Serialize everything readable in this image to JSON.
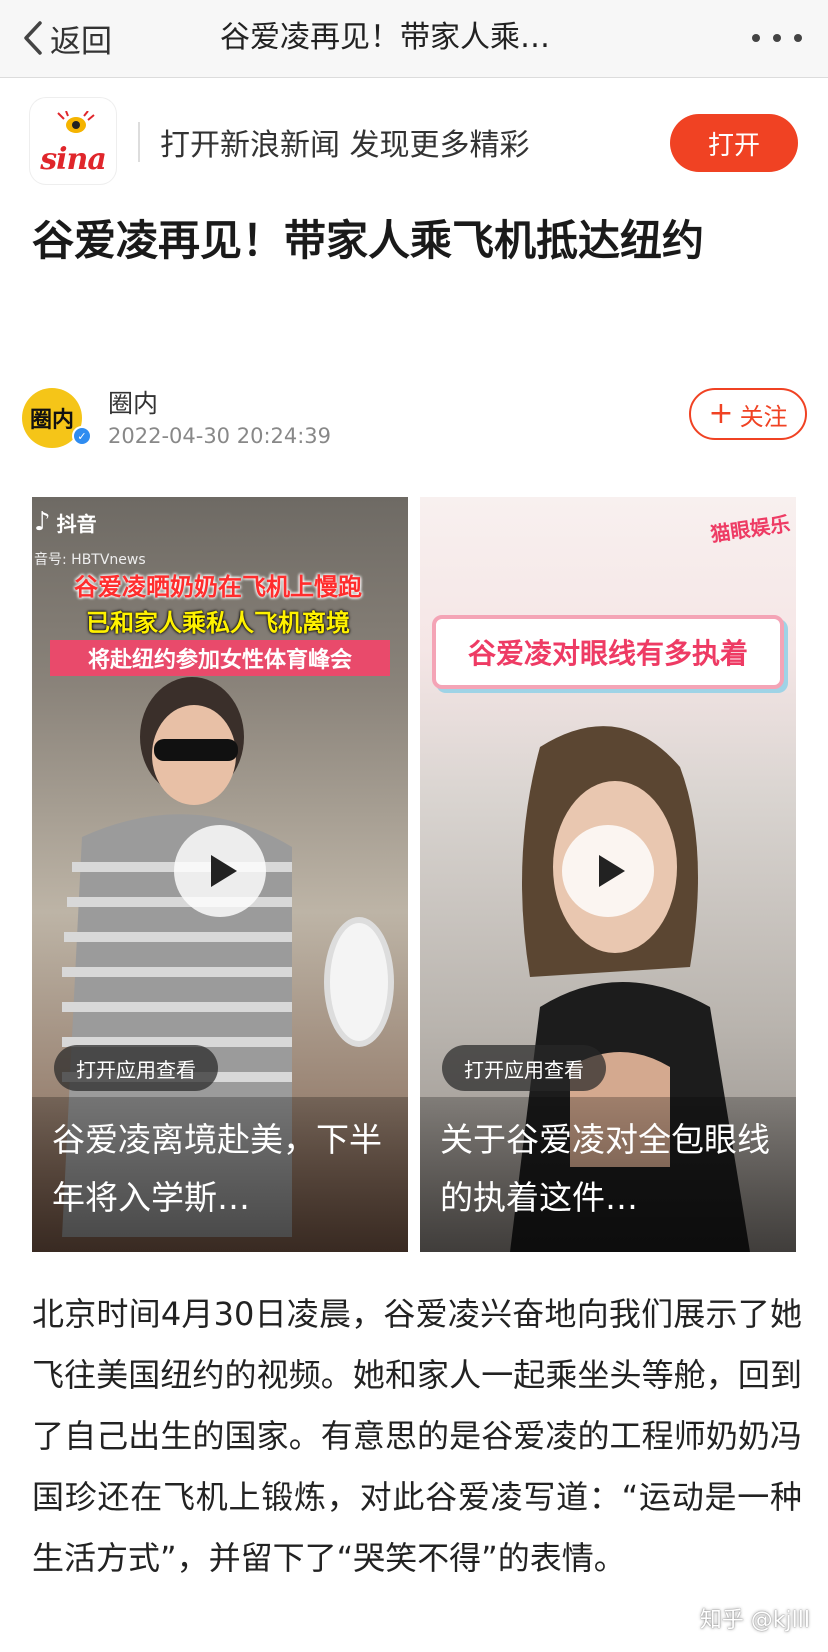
{
  "navbar": {
    "back_label": "返回",
    "title": "谷爱凌再见！带家人乘…"
  },
  "app_banner": {
    "logo_text": "sina",
    "slogan": "打开新浪新闻 发现更多精彩",
    "open_button": "打开"
  },
  "article": {
    "title": "谷爱凌再见！带家人乘飞机抵达纽约",
    "author": {
      "avatar_text": "圈内",
      "name": "圈内",
      "timestamp": "2022-04-30 20:24:39",
      "follow_label": "关注"
    },
    "videos": [
      {
        "platform": "抖音",
        "platform_id": "音号: HBTVnews",
        "overlay_lines": [
          "谷爱凌晒奶奶在飞机上慢跑",
          "已和家人乘私人飞机离境",
          "将赴纽约参加女性体育峰会"
        ],
        "open_app_label": "打开应用查看",
        "caption": "谷爱凌离境赴美，下半年将入学斯…"
      },
      {
        "sticker": "猫眼娱乐",
        "overlay_banner": "谷爱凌对眼线有多执着",
        "open_app_label": "打开应用查看",
        "caption": "关于谷爱凌对全包眼线的执着这件…"
      }
    ],
    "body": "北京时间4月30日凌晨，谷爱凌兴奋地向我们展示了她飞往美国纽约的视频。她和家人一起乘坐头等舱，回到了自己出生的国家。有意思的是谷爱凌的工程师奶奶冯国珍还在飞机上锻炼，对此谷爱凌写道：“运动是一种生活方式”，并留下了“哭笑不得”的表情。"
  },
  "watermark": "知乎 @kjlll",
  "colors": {
    "accent_red": "#f04223",
    "navbar_bg": "#f7f7f7",
    "verified_blue": "#2f8cf0"
  }
}
